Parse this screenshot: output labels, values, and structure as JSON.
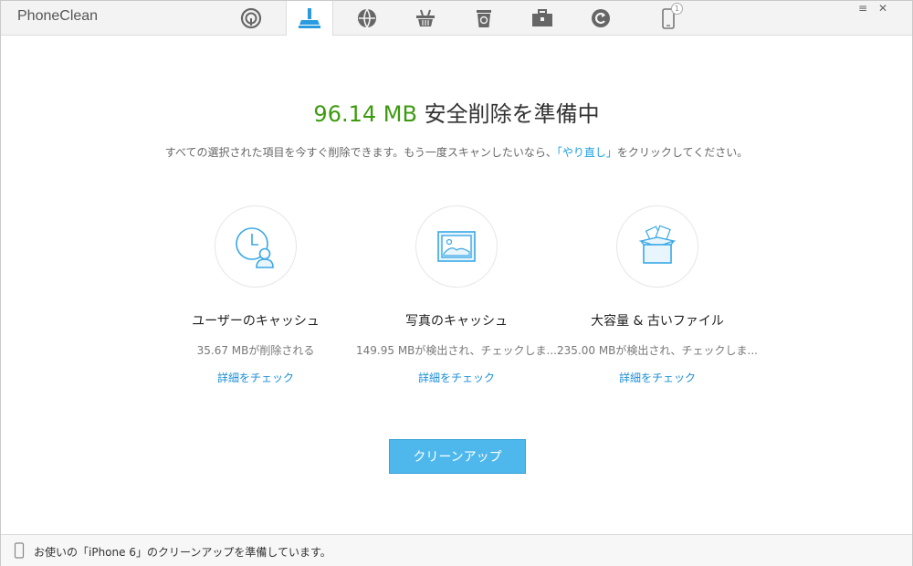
{
  "app": {
    "title": "PhoneClean"
  },
  "toolbar": {
    "tabs": [
      {
        "icon": "fingerprint-scan-icon"
      },
      {
        "icon": "broom-clean-icon",
        "active": true
      },
      {
        "icon": "internet-globe-icon"
      },
      {
        "icon": "basket-icon"
      },
      {
        "icon": "recycle-bin-icon"
      },
      {
        "icon": "toolbox-icon"
      },
      {
        "icon": "restore-icon"
      },
      {
        "icon": "phone-device-icon",
        "badge": "1"
      }
    ],
    "menu_icon": "≡",
    "close_icon": "✕"
  },
  "main": {
    "size": "96.14 MB",
    "headline": " 安全削除を準備中",
    "description_before": "すべての選択された項目を今すぐ削除できます。もう一度スキャンしたいなら、",
    "retry_link": "「やり直し」",
    "description_after": "をクリックしてください。"
  },
  "cards": [
    {
      "icon": "user-cache-clock-icon",
      "title": "ユーザーのキャッシュ",
      "stat": "35.67 MBが削除される",
      "link": "詳細をチェック"
    },
    {
      "icon": "photo-cache-icon",
      "title": "写真のキャッシュ",
      "stat": "149.95 MBが検出され、チェックしま...",
      "link": "詳細をチェック"
    },
    {
      "icon": "large-old-files-box-icon",
      "title": "大容量 & 古いファイル",
      "stat": "235.00 MBが検出され、チェックしま...",
      "link": "詳細をチェック"
    }
  ],
  "cleanup_button": "クリーンアップ",
  "status": {
    "text": "お使いの「iPhone 6」のクリーンアップを準備しています。"
  },
  "colors": {
    "accent": "#4eb8ec",
    "success": "#3d9a0f",
    "link": "#1b8ed8",
    "icon": "#2a9be0"
  }
}
